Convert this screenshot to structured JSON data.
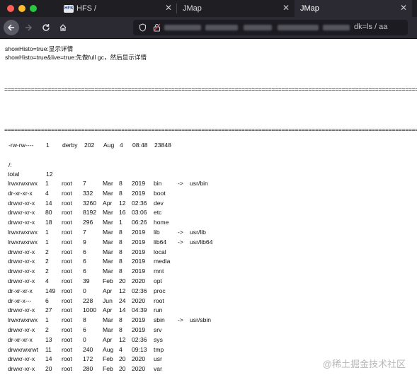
{
  "browser": {
    "tabs": [
      {
        "label": "HFS /",
        "favicon": "HFS"
      },
      {
        "label": "JMap"
      },
      {
        "label": "JMap"
      }
    ],
    "url_suffix": "dk=ls / aa",
    "colors": {
      "close": "#ff5f57",
      "minimize": "#febc2e",
      "maximize": "#28c840",
      "accent": "#2b2a33"
    }
  },
  "page": {
    "help_line1": "showHisto=true:显示详情",
    "help_line2": "showHisto=true&live=true:先做full gc，然后显示详情",
    "separator": "=============================================================================================================================================================================================================",
    "file": {
      "perm": "-rw-rw----",
      "links": "1",
      "owner": "derby",
      "size": "202",
      "month": "Aug",
      "day": "4",
      "time": "08:48",
      "name": "23848"
    },
    "dir_label": "/:",
    "total": {
      "label": "total",
      "value": "12"
    },
    "entries": [
      [
        "lrwxrwxrwx",
        "1",
        "root",
        "7",
        "Mar",
        "8",
        "2019",
        "bin",
        "->",
        "usr/bin"
      ],
      [
        "dr-xr-xr-x",
        "4",
        "root",
        "332",
        "Mar",
        "8",
        "2019",
        "boot",
        "",
        ""
      ],
      [
        "drwxr-xr-x",
        "14",
        "root",
        "3260",
        "Apr",
        "12",
        "02:36",
        "dev",
        "",
        ""
      ],
      [
        "drwxr-xr-x",
        "80",
        "root",
        "8192",
        "Mar",
        "16",
        "03:06",
        "etc",
        "",
        ""
      ],
      [
        "drwxr-xr-x",
        "18",
        "root",
        "296",
        "Mar",
        "1",
        "06:26",
        "home",
        "",
        ""
      ],
      [
        "lrwxrwxrwx",
        "1",
        "root",
        "7",
        "Mar",
        "8",
        "2019",
        "lib",
        "->",
        "usr/lib"
      ],
      [
        "lrwxrwxrwx",
        "1",
        "root",
        "9",
        "Mar",
        "8",
        "2019",
        "lib64",
        "->",
        "usr/lib64"
      ],
      [
        "drwxr-xr-x",
        "2",
        "root",
        "6",
        "Mar",
        "8",
        "2019",
        "local",
        "",
        ""
      ],
      [
        "drwxr-xr-x",
        "2",
        "root",
        "6",
        "Mar",
        "8",
        "2019",
        "media",
        "",
        ""
      ],
      [
        "drwxr-xr-x",
        "2",
        "root",
        "6",
        "Mar",
        "8",
        "2019",
        "mnt",
        "",
        ""
      ],
      [
        "drwxr-xr-x",
        "4",
        "root",
        "39",
        "Feb",
        "20",
        "2020",
        "opt",
        "",
        ""
      ],
      [
        "dr-xr-xr-x",
        "149",
        "root",
        "0",
        "Apr",
        "12",
        "02:36",
        "proc",
        "",
        ""
      ],
      [
        "dr-xr-x---",
        "6",
        "root",
        "228",
        "Jun",
        "24",
        "2020",
        "root",
        "",
        ""
      ],
      [
        "drwxr-xr-x",
        "27",
        "root",
        "1000",
        "Apr",
        "14",
        "04:39",
        "run",
        "",
        ""
      ],
      [
        "lrwxrwxrwx",
        "1",
        "root",
        "8",
        "Mar",
        "8",
        "2019",
        "sbin",
        "->",
        "usr/sbin"
      ],
      [
        "drwxr-xr-x",
        "2",
        "root",
        "6",
        "Mar",
        "8",
        "2019",
        "srv",
        "",
        ""
      ],
      [
        "dr-xr-xr-x",
        "13",
        "root",
        "0",
        "Apr",
        "12",
        "02:36",
        "sys",
        "",
        ""
      ],
      [
        "drwxrwxrwt",
        "11",
        "root",
        "240",
        "Aug",
        "4",
        "09:13",
        "tmp",
        "",
        ""
      ],
      [
        "drwxr-xr-x",
        "14",
        "root",
        "172",
        "Feb",
        "20",
        "2020",
        "usr",
        "",
        ""
      ],
      [
        "drwxr-xr-x",
        "20",
        "root",
        "280",
        "Feb",
        "20",
        "2020",
        "var",
        "",
        ""
      ]
    ],
    "watermark": "@稀土掘金技术社区"
  }
}
